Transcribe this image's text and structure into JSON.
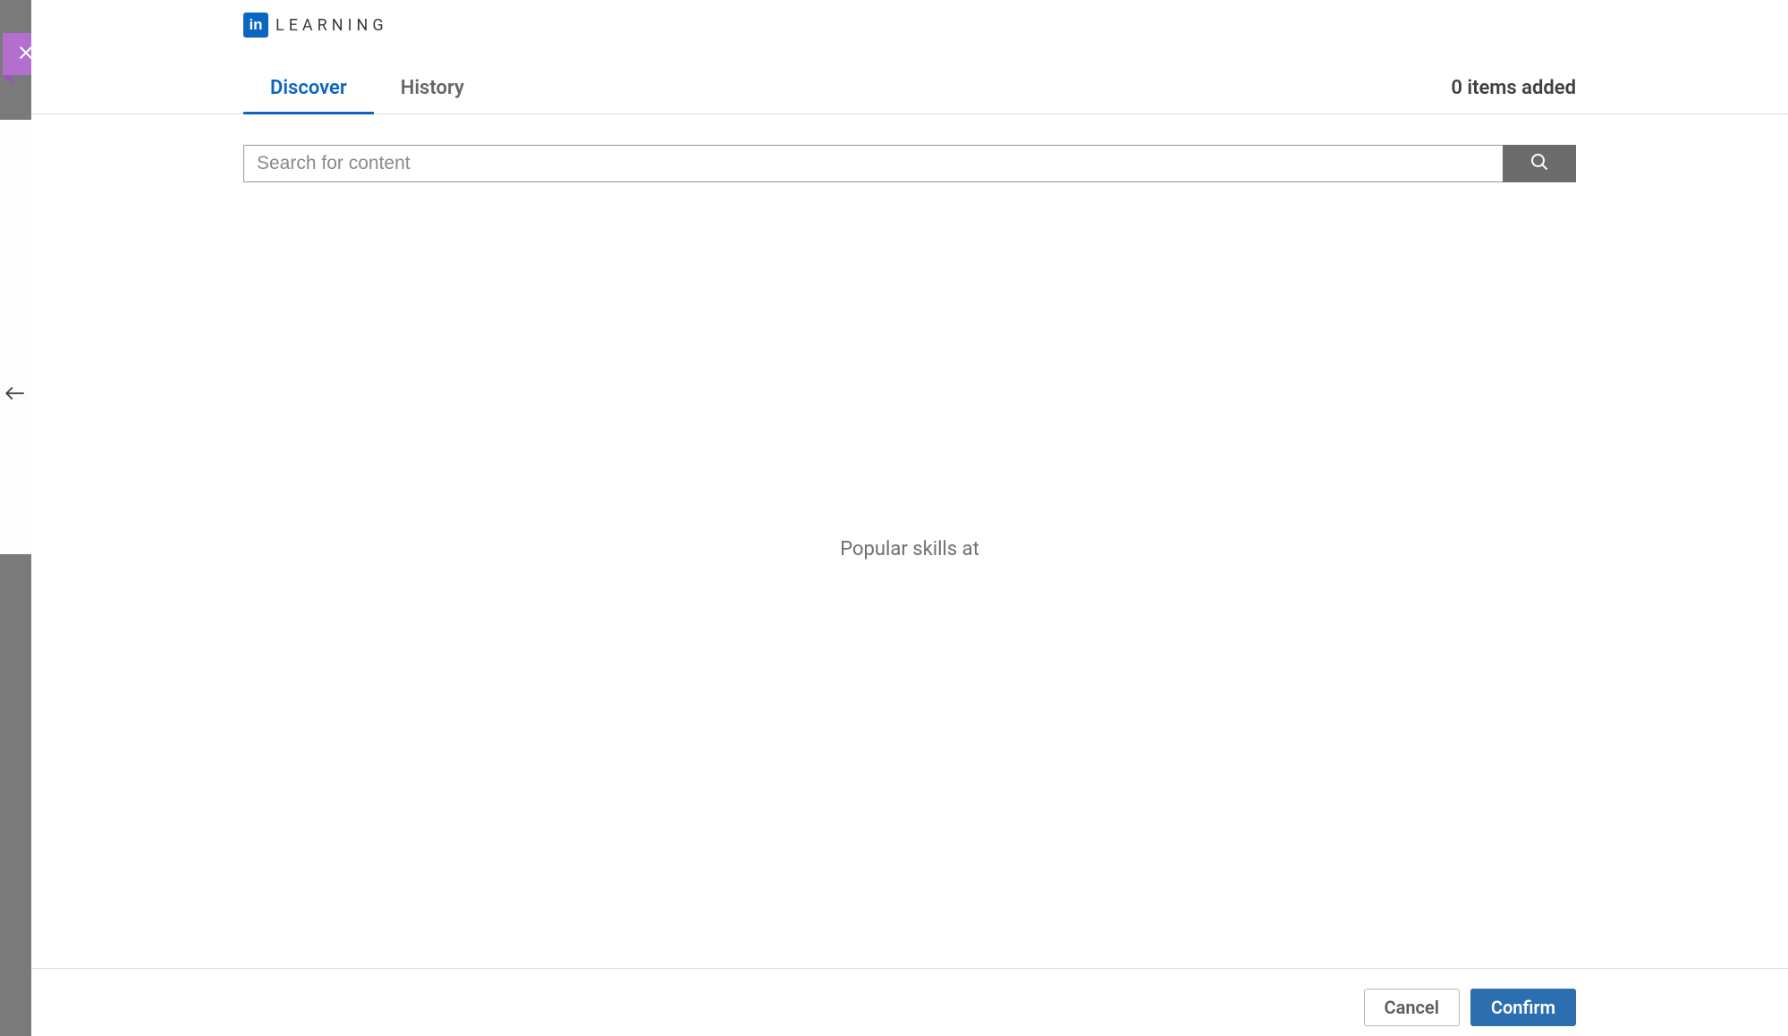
{
  "brand": {
    "logo_short": "in",
    "logo_text": "LEARNING"
  },
  "close": {
    "icon_name": "close-icon"
  },
  "tabs": {
    "discover": "Discover",
    "history": "History"
  },
  "header": {
    "items_added": "0 items added"
  },
  "search": {
    "placeholder": "Search for content",
    "value": ""
  },
  "body": {
    "popular_skills_label": "Popular skills at"
  },
  "footer": {
    "cancel": "Cancel",
    "confirm": "Confirm"
  },
  "backdrop": {
    "back_arrow_name": "back-arrow-icon"
  }
}
